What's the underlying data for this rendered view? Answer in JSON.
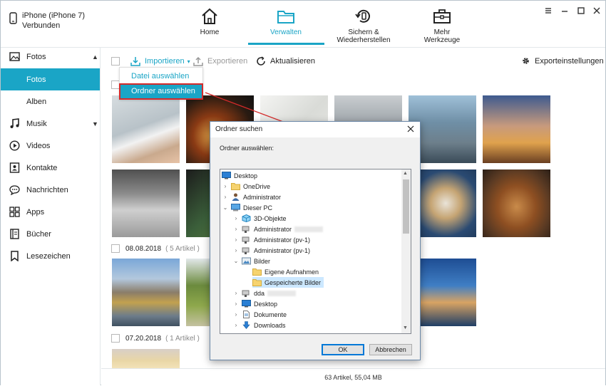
{
  "device": {
    "name": "iPhone (iPhone 7)",
    "status": "Verbunden"
  },
  "nav": [
    {
      "label": "Home",
      "icon": "home-icon"
    },
    {
      "label": "Verwalten",
      "icon": "folder-icon",
      "active": true
    },
    {
      "label": "Sichern & Wiederherstellen",
      "icon": "restore-icon"
    },
    {
      "label": "Mehr Werkzeuge",
      "icon": "toolbox-icon"
    }
  ],
  "sidebar": {
    "items": [
      {
        "label": "Fotos"
      },
      {
        "label": "Fotos"
      },
      {
        "label": "Alben"
      },
      {
        "label": "Musik"
      },
      {
        "label": "Videos"
      },
      {
        "label": "Kontakte"
      },
      {
        "label": "Nachrichten"
      },
      {
        "label": "Apps"
      },
      {
        "label": "Bücher"
      },
      {
        "label": "Lesezeichen"
      }
    ]
  },
  "toolbar": {
    "import": "Importieren",
    "export": "Exportieren",
    "refresh": "Aktualisieren",
    "export_settings": "Exporteinstellungen"
  },
  "import_menu": {
    "file": "Datei auswählen",
    "folder": "Ordner auswählen"
  },
  "groups": [
    {
      "date": "08.08.2018",
      "count": "( 5 Artikel )"
    },
    {
      "date": "07.20.2018",
      "count": "( 1 Artikel )"
    }
  ],
  "status_bar": "63 Artikel, 55,04 MB",
  "dialog": {
    "title": "Ordner suchen",
    "prompt": "Ordner auswählen:",
    "tree": [
      {
        "label": "Desktop"
      },
      {
        "label": "OneDrive"
      },
      {
        "label": "Administrator"
      },
      {
        "label": "Dieser PC"
      },
      {
        "label": "3D-Objekte"
      },
      {
        "label": "Administrator"
      },
      {
        "label": "Administrator (pv-1)"
      },
      {
        "label": "Administrator (pv-1)"
      },
      {
        "label": "Bilder"
      },
      {
        "label": "Eigene Aufnahmen"
      },
      {
        "label": "Gespeicherte Bilder"
      },
      {
        "label": "dda"
      },
      {
        "label": "Desktop"
      },
      {
        "label": "Dokumente"
      },
      {
        "label": "Downloads"
      }
    ],
    "ok": "OK",
    "cancel": "Abbrechen"
  },
  "colors": {
    "accent": "#1aa5c6",
    "highlight_border": "#d42a2a"
  }
}
